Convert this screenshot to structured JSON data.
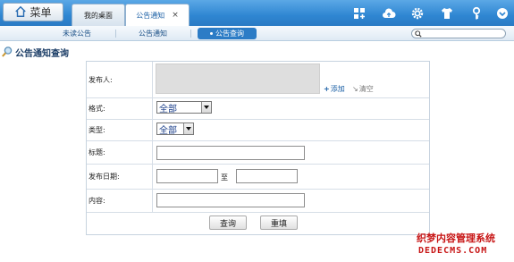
{
  "topbar": {
    "menu_label": "菜单",
    "tabs": [
      {
        "label": "我的桌面"
      },
      {
        "label": "公告通知",
        "close": "×"
      }
    ],
    "tools": [
      "layout-icon",
      "cloud-upload-icon",
      "gear-icon",
      "shirt-icon",
      "key-icon",
      "chevron-down-icon"
    ]
  },
  "subtabs": [
    {
      "label": "未读公告"
    },
    {
      "label": "公告通知"
    },
    {
      "label": "公告查询",
      "active": true
    }
  ],
  "page": {
    "title": "公告通知查询"
  },
  "form": {
    "publisher_label": "发布人:",
    "add_label": "添加",
    "clear_label": "清空",
    "format_label": "格式:",
    "format_value": "全部",
    "type_label": "类型:",
    "type_value": "全部",
    "title_label": "标题:",
    "date_label": "发布日期:",
    "date_to": "至",
    "content_label": "内容:",
    "query_button": "查询",
    "reset_button": "重填"
  },
  "watermark": {
    "line1": "织梦内容管理系统",
    "line2": "DEDECMS.COM"
  },
  "colors": {
    "topbar": "#2f86d2",
    "accent": "#2c7cc6",
    "link": "#1a5fa5",
    "watermark": "#c71414"
  }
}
